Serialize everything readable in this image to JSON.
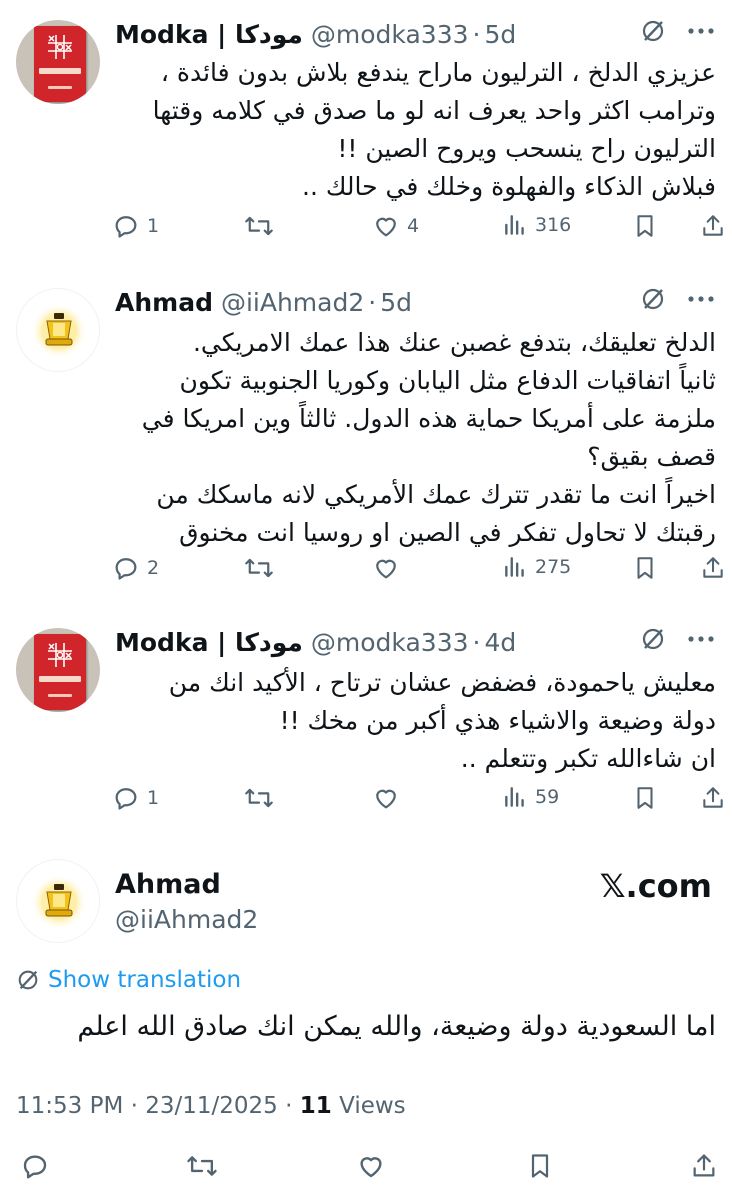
{
  "replies": [
    {
      "name": "Modka | مودكا",
      "handle": "@modka333",
      "time": "5d",
      "avatar": "book-cover-avatar",
      "text_lines": [
        "عزيزي الدلخ ، الترليون ماراح يندفع بلاش بدون فائدة ،",
        "وترامب اكثر واحد يعرف انه لو ما صدق في كلامه وقتها",
        "الترليون راح ينسحب ويروح الصين !!",
        "فبلاش الذكاء والفهلوة وخلك في حالك .."
      ],
      "replies_count": "1",
      "retweets_count": "",
      "likes_count": "4",
      "views_count": "316"
    },
    {
      "name": "Ahmad",
      "handle": "@iiAhmad2",
      "time": "5d",
      "avatar": "lamp-avatar",
      "text_lines": [
        "الدلخ تعليقك، بتدفع غصبن عنك هذا عمك الامريكي.",
        "ثانياً اتفاقيات الدفاع مثل اليابان وكوريا الجنوبية تكون",
        "ملزمة على أمريكا حماية هذه الدول. ثالثاً وين امريكا في",
        "قصف بقيق؟",
        "اخيراً انت ما تقدر تترك عمك الأمريكي لانه ماسكك من",
        "رقبتك لا تحاول تفكر في الصين او روسيا انت مخنوق"
      ],
      "replies_count": "2",
      "retweets_count": "",
      "likes_count": "",
      "views_count": "275"
    },
    {
      "name": "Modka | مودكا",
      "handle": "@modka333",
      "time": "4d",
      "avatar": "book-cover-avatar",
      "text_lines": [
        "معليش ياحمودة،  فضفض عشان ترتاح ، الأكيد انك من",
        "دولة وضيعة والاشياء هذي أكبر من مخك !!",
        "ان شاءالله تكبر وتتعلم  .."
      ],
      "replies_count": "1",
      "retweets_count": "",
      "likes_count": "",
      "views_count": "59"
    }
  ],
  "main": {
    "name": "Ahmad",
    "handle": "@iiAhmad2",
    "brand": "𝕏.com",
    "show_translation": "Show translation",
    "text": "اما السعودية دولة وضيعة، والله يمكن انك صادق الله اعلم",
    "time": "11:53 PM",
    "date": "23/11/2025",
    "views_count": "11",
    "views_label": "Views"
  },
  "colors": {
    "text": "#0f1419",
    "secondary": "#536471",
    "link": "#1d9bf0",
    "book_red": "#d0262b"
  }
}
